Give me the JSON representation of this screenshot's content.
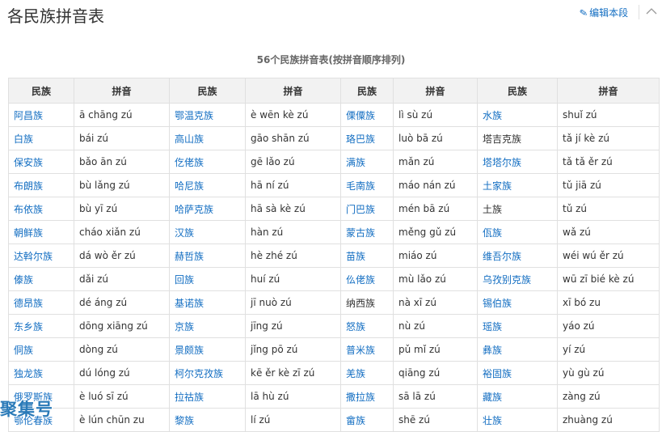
{
  "page": {
    "title": "各民族拼音表",
    "edit_label": "编辑本段",
    "caption": "56个民族拼音表(按拼音顺序排列)"
  },
  "table": {
    "headers": [
      "民族",
      "拼音",
      "民族",
      "拼音",
      "民族",
      "拼音",
      "民族",
      "拼音"
    ],
    "rows": [
      [
        [
          "阿昌族",
          "ā chāng zú"
        ],
        [
          "鄂温克族",
          "è wēn kè zú"
        ],
        [
          "傈僳族",
          "lì sù zú"
        ],
        [
          "水族",
          "shuǐ zú"
        ]
      ],
      [
        [
          "白族",
          "bái zú"
        ],
        [
          "高山族",
          "gāo shān zú"
        ],
        [
          "珞巴族",
          "luò bā zú"
        ],
        [
          "塔吉克族",
          "tǎ jí kè zú"
        ]
      ],
      [
        [
          "保安族",
          "bǎo ān zú"
        ],
        [
          "仡佬族",
          "gē lǎo zú"
        ],
        [
          "满族",
          "mǎn zú"
        ],
        [
          "塔塔尔族",
          "tǎ tǎ ěr zú"
        ]
      ],
      [
        [
          "布朗族",
          "bù lǎng zú"
        ],
        [
          "哈尼族",
          "hā ní zú"
        ],
        [
          "毛南族",
          "máo nán zú"
        ],
        [
          "土家族",
          "tǔ jiā zú"
        ]
      ],
      [
        [
          "布依族",
          "bù yī zú"
        ],
        [
          "哈萨克族",
          "hā sà kè zú"
        ],
        [
          "门巴族",
          "mén bā zú"
        ],
        [
          "土族",
          "tǔ zú"
        ]
      ],
      [
        [
          "朝鲜族",
          "cháo xiǎn zú"
        ],
        [
          "汉族",
          "hàn zú"
        ],
        [
          "蒙古族",
          "měng gǔ zú"
        ],
        [
          "佤族",
          "wǎ zú"
        ]
      ],
      [
        [
          "达斡尔族",
          "dá wò ěr zú"
        ],
        [
          "赫哲族",
          "hè zhé zú"
        ],
        [
          "苗族",
          "miáo zú"
        ],
        [
          "维吾尔族",
          "wéi wú ěr zú"
        ]
      ],
      [
        [
          "傣族",
          "dǎi zú"
        ],
        [
          "回族",
          "huí zú"
        ],
        [
          "仫佬族",
          "mù lǎo zú"
        ],
        [
          "乌孜别克族",
          "wū zī bié kè zú"
        ]
      ],
      [
        [
          "德昂族",
          "dé áng zú"
        ],
        [
          "基诺族",
          "jī nuò zú"
        ],
        [
          "纳西族",
          "nà xī zú"
        ],
        [
          "锡伯族",
          "xī bó zu"
        ]
      ],
      [
        [
          "东乡族",
          "dōng xiāng zú"
        ],
        [
          "京族",
          "jīng zú"
        ],
        [
          "怒族",
          "nù zú"
        ],
        [
          "瑶族",
          "yáo zú"
        ]
      ],
      [
        [
          "侗族",
          "dòng zú"
        ],
        [
          "景颇族",
          "jǐng pō zú"
        ],
        [
          "普米族",
          "pǔ mǐ zú"
        ],
        [
          "彝族",
          "yí zú"
        ]
      ],
      [
        [
          "独龙族",
          "dú lóng zú"
        ],
        [
          "柯尔克孜族",
          "kē ěr kè zī zú"
        ],
        [
          "羌族",
          "qiāng zú"
        ],
        [
          "裕固族",
          "yù gù zú"
        ]
      ],
      [
        [
          "俄罗斯族",
          "è luó sī zú"
        ],
        [
          "拉祜族",
          "lā hù zú"
        ],
        [
          "撒拉族",
          "sā lā zú"
        ],
        [
          "藏族",
          "zàng zú"
        ]
      ],
      [
        [
          "鄂伦春族",
          "è lún chūn zu"
        ],
        [
          "黎族",
          "lí zú"
        ],
        [
          "畲族",
          "shē zú"
        ],
        [
          "壮族",
          "zhuàng zú"
        ]
      ]
    ],
    "plain_ethnic": [
      "塔吉克族",
      "土族",
      "纳西族"
    ]
  },
  "watermark": "聚集号",
  "colors": {
    "link": "#136ec2",
    "header_bg": "#f2f2f2",
    "border": "#e0e0e0"
  },
  "icons": {
    "edit": "pencil-icon",
    "collapse": "chevron-up-icon"
  }
}
